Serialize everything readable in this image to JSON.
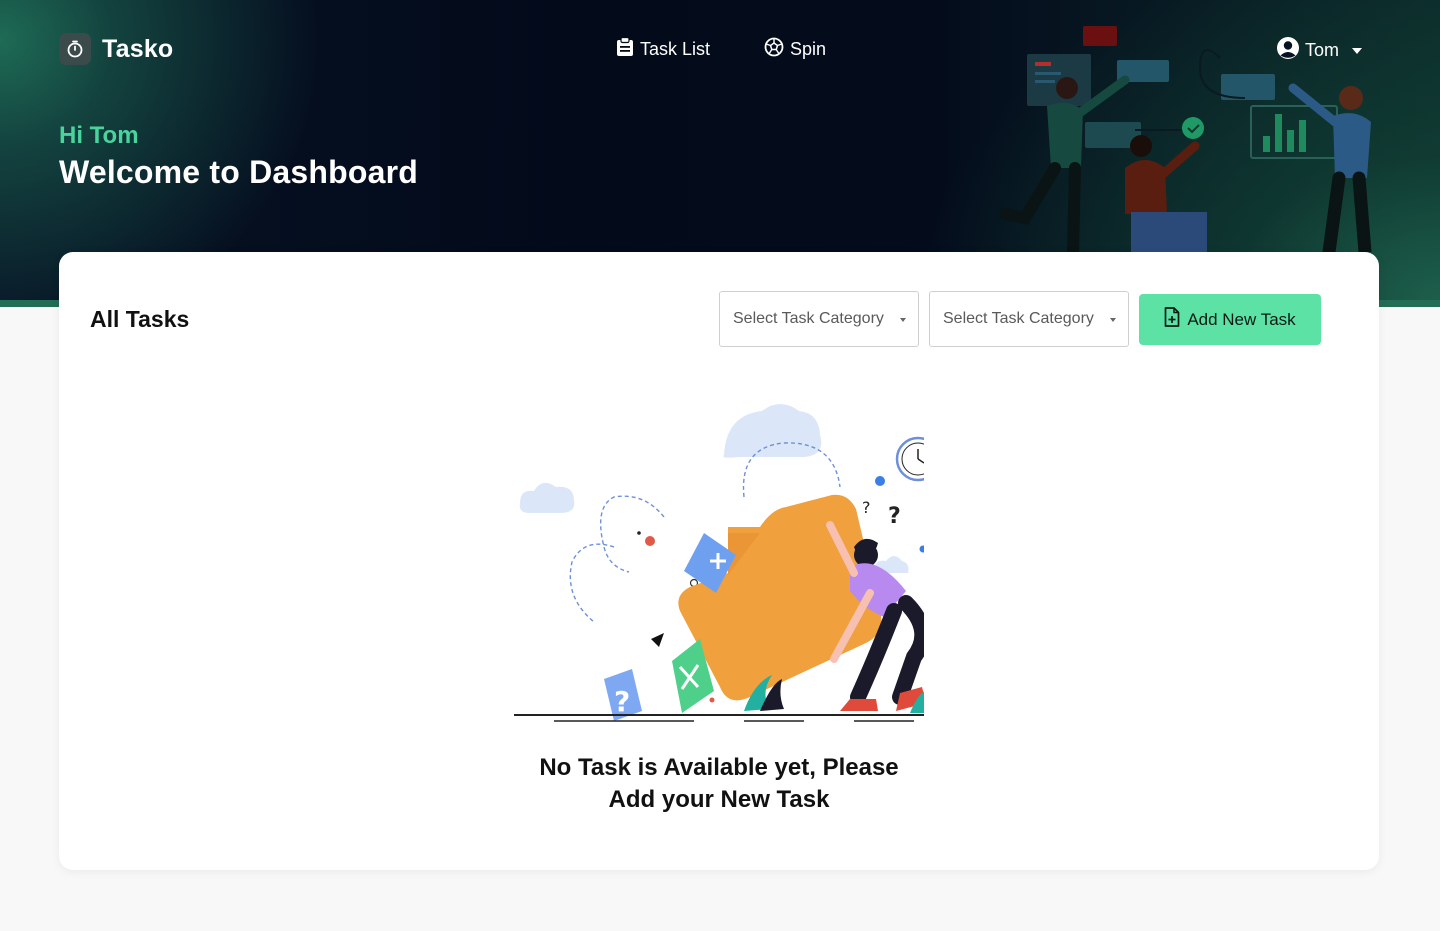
{
  "app": {
    "name": "Tasko",
    "logo_icon": "stopwatch-icon"
  },
  "nav": {
    "task_list": {
      "label": "Task List",
      "icon": "clipboard-icon"
    },
    "spin": {
      "label": "Spin",
      "icon": "soccer-ball-icon"
    }
  },
  "user": {
    "name": "Tom",
    "icon": "user-circle-icon"
  },
  "hero": {
    "greeting": "Hi Tom",
    "title": "Welcome to Dashboard"
  },
  "tasks": {
    "title": "All Tasks",
    "filter_1": {
      "placeholder": "Select Task Category"
    },
    "filter_2": {
      "placeholder": "Select Task Category"
    },
    "add_button": {
      "label": "Add New Task",
      "icon": "file-plus-icon"
    },
    "empty_line_1": "No Task is Available yet, Please",
    "empty_line_2": "Add your New Task"
  },
  "colors": {
    "accent": "#4ad39c",
    "button": "#5ce2a5",
    "hero_bg": "#030a1a",
    "folder": "#f0a03c"
  }
}
